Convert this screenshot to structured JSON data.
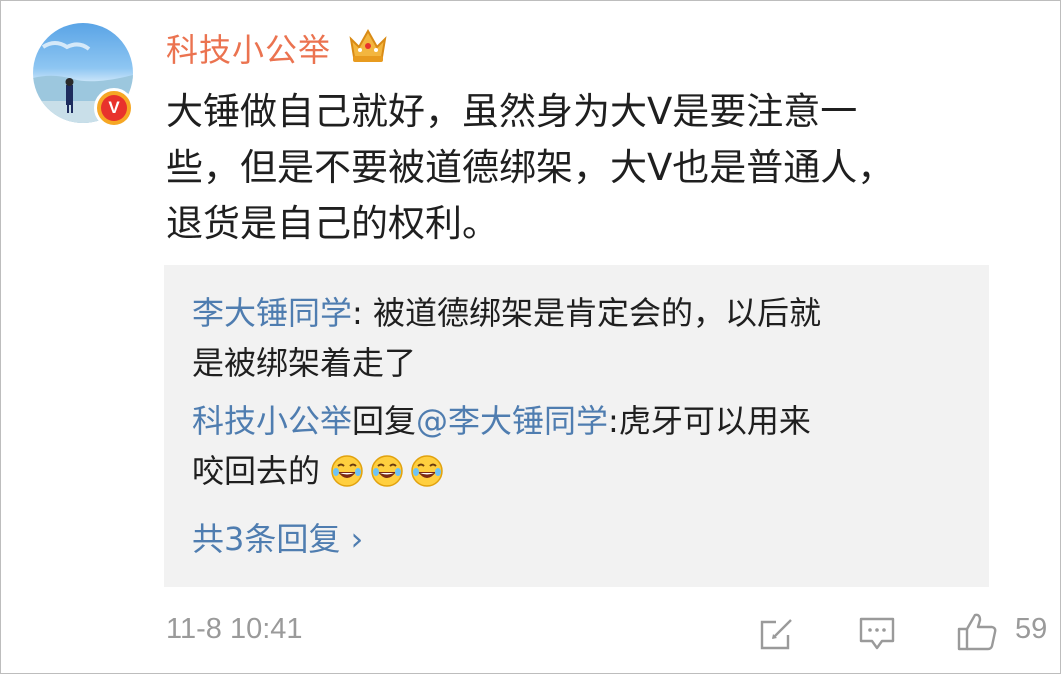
{
  "comment": {
    "username": "科技小公举",
    "text_lines": [
      "大锤做自己就好，虽然身为大V是要注意一",
      "些，但是不要被道德绑架，大V也是普通人，",
      "退货是自己的权利。"
    ],
    "timestamp": "11-8 10:41",
    "like_count": "59",
    "verified_badge_letter": "V",
    "colors": {
      "username": "#eb7350",
      "link_blue": "#4f7db0",
      "reply_bg": "#f2f2f2",
      "meta_gray": "#9a9a9a"
    },
    "icons": {
      "crown": "crown-member-icon",
      "share": "share-icon",
      "comment": "comment-icon",
      "like": "thumbs-up-icon"
    }
  },
  "replies": [
    {
      "author": "李大锤同学",
      "separator": ": ",
      "line1": "被道德绑架是肯定会的，以后就",
      "line2": "是被绑架着走了"
    },
    {
      "author": "科技小公举",
      "reply_word": "回复",
      "mention": "@李大锤同学",
      "separator": ":",
      "line1": "虎牙可以用来",
      "line2": "咬回去的",
      "emoji": "laughing-tears-emoji"
    }
  ],
  "more_replies_label": "共3条回复 ›"
}
